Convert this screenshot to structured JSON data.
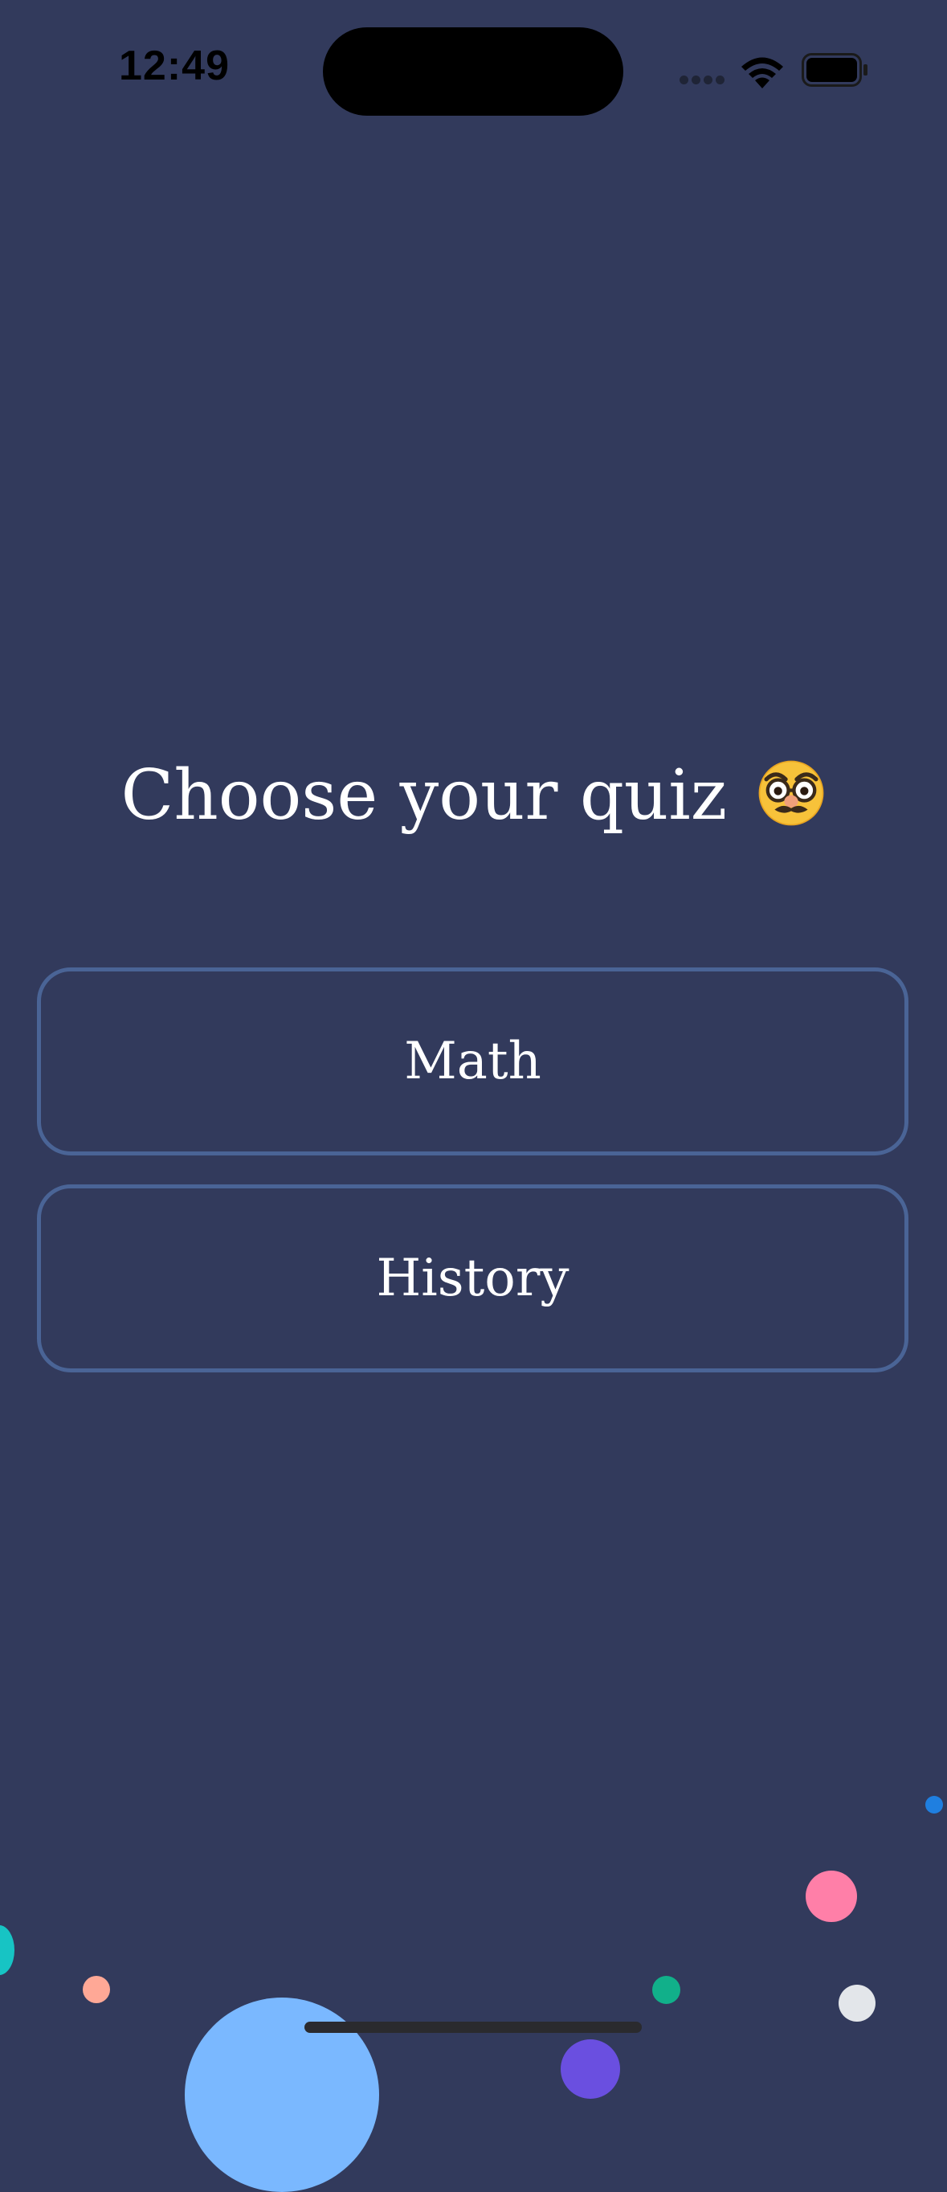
{
  "status_bar": {
    "time": "12:49",
    "icons": [
      "cellular-signal-icon",
      "wifi-icon",
      "battery-icon"
    ]
  },
  "title": {
    "text": "Choose your quiz",
    "emoji_icon": "disguised-face-icon"
  },
  "quiz_options": [
    {
      "label": "Math"
    },
    {
      "label": "History"
    }
  ],
  "colors": {
    "background": "#323a5c",
    "button_border": "#4a6496",
    "text": "#ffffff"
  },
  "decorations": {
    "confetti_colors": [
      "#1f7fe0",
      "#ff7fa8",
      "#17c4c4",
      "#ffa896",
      "#11b08a",
      "#e3e6ea",
      "#7ab8ff",
      "#6a4fe0"
    ]
  }
}
